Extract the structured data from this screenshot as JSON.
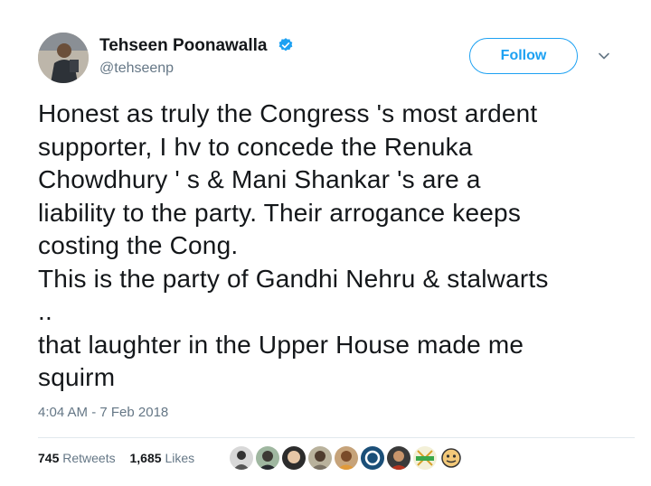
{
  "user": {
    "display_name": "Tehseen Poonawalla",
    "handle": "@tehseenp",
    "verified": true
  },
  "follow_button": {
    "label": "Follow"
  },
  "tweet": {
    "lines": [
      "Honest as truly the Congress 's most ardent",
      "supporter, I hv to concede the Renuka",
      "Chowdhury ' s & Mani Shankar 's are a",
      "liability to the party. Their arrogance keeps",
      "costing the Cong.",
      "This is the party of Gandhi Nehru & stalwarts",
      "..",
      "that laughter in the Upper House made me",
      "squirm"
    ],
    "timestamp": "4:04 AM - 7 Feb 2018"
  },
  "stats": {
    "retweets_count": "745",
    "retweets_label": "Retweets",
    "likes_count": "1,685",
    "likes_label": "Likes"
  },
  "colors": {
    "accent": "#1da1f2",
    "text": "#14171a",
    "secondary": "#657786"
  }
}
